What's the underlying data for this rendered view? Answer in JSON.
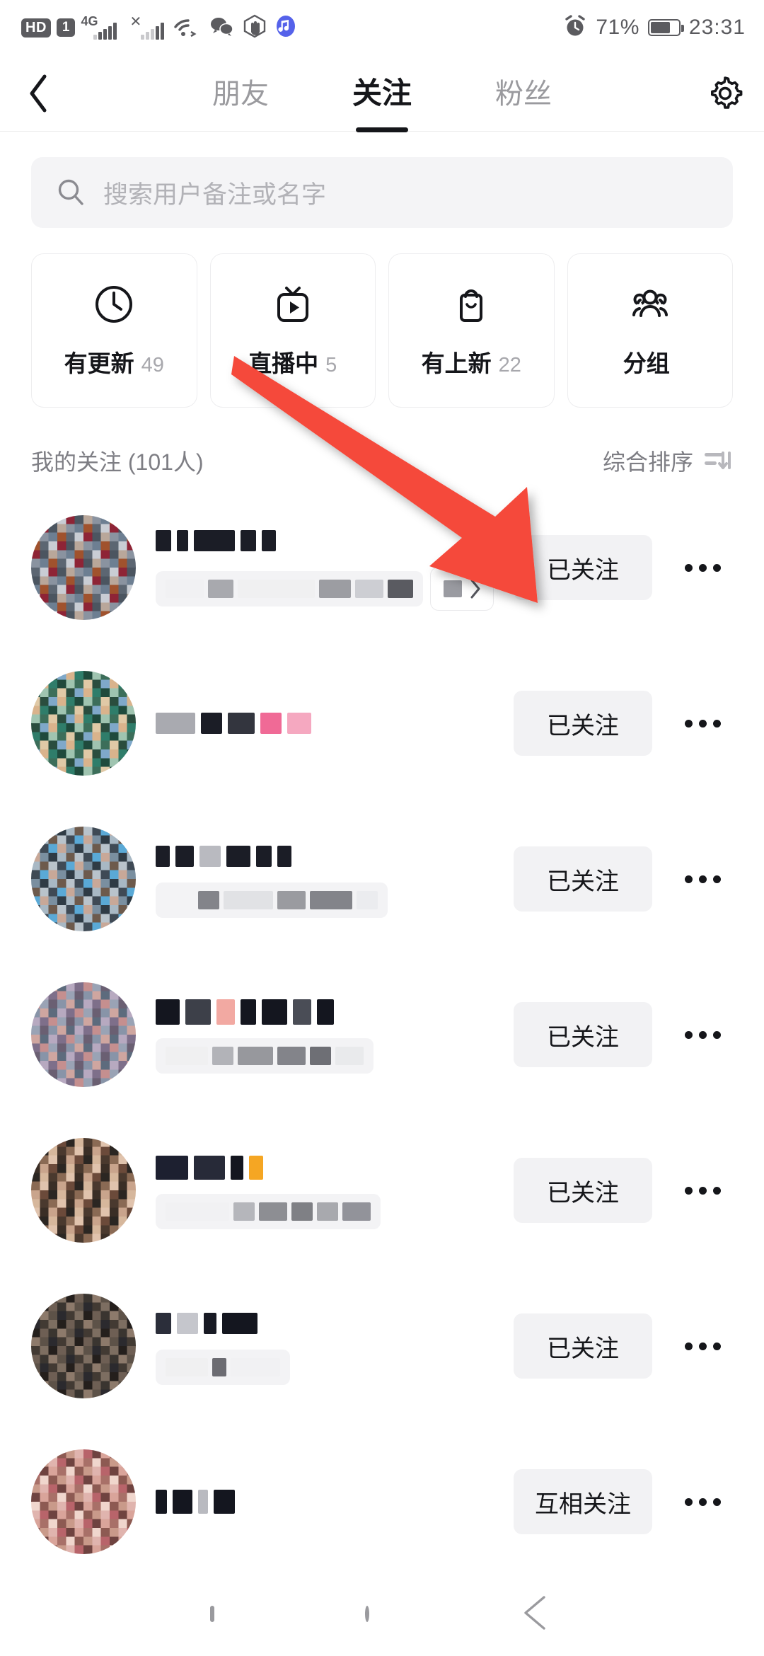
{
  "status_bar": {
    "hd_badge": "HD",
    "sim_badge": "1",
    "network_type": "4G",
    "battery_percent": "71%",
    "time": "23:31",
    "icons": [
      "hd-icon",
      "sim-card-icon",
      "signal-bars-icon",
      "no-signal-icon",
      "wifi-icon",
      "wechat-icon",
      "do-not-disturb-icon",
      "music-icon",
      "alarm-icon",
      "battery-icon"
    ]
  },
  "header": {
    "back_icon": "chevron-left-icon",
    "settings_icon": "gear-icon",
    "tabs": [
      {
        "label": "朋友",
        "active": false
      },
      {
        "label": "关注",
        "active": true
      },
      {
        "label": "粉丝",
        "active": false
      }
    ]
  },
  "search": {
    "placeholder": "搜索用户备注或名字",
    "icon": "search-icon"
  },
  "filter_cards": [
    {
      "label": "有更新",
      "count": "49",
      "icon": "clock-icon"
    },
    {
      "label": "直播中",
      "count": "5",
      "icon": "live-tv-icon"
    },
    {
      "label": "有上新",
      "count": "22",
      "icon": "shopping-bag-icon"
    },
    {
      "label": "分组",
      "count": "",
      "icon": "group-people-icon"
    }
  ],
  "section": {
    "title": "我的关注 (101人)",
    "sort_label": "综合排序",
    "sort_icon": "sort-icon"
  },
  "list": {
    "rows": [
      {
        "name_redacted": true,
        "has_subtitle": true,
        "has_tagchip": true,
        "button": "已关注",
        "more": "more-options-icon"
      },
      {
        "name_redacted": true,
        "has_subtitle": false,
        "has_tagchip": false,
        "button": "已关注",
        "more": "more-options-icon"
      },
      {
        "name_redacted": true,
        "has_subtitle": true,
        "has_tagchip": false,
        "button": "已关注",
        "more": "more-options-icon"
      },
      {
        "name_redacted": true,
        "has_subtitle": true,
        "has_tagchip": false,
        "button": "已关注",
        "more": "more-options-icon"
      },
      {
        "name_redacted": true,
        "has_subtitle": true,
        "has_tagchip": false,
        "button": "已关注",
        "more": "more-options-icon"
      },
      {
        "name_redacted": true,
        "has_subtitle": true,
        "has_tagchip": false,
        "button": "已关注",
        "more": "more-options-icon"
      },
      {
        "name_redacted": true,
        "has_subtitle": false,
        "has_tagchip": false,
        "button": "互相关注",
        "more": "more-options-icon"
      }
    ]
  },
  "annotation": {
    "type": "arrow",
    "color": "#F5483B",
    "points_to": "已关注"
  },
  "nav_bar": {
    "recents_icon": "square-icon",
    "home_icon": "circle-icon",
    "back_icon": "triangle-back-icon"
  },
  "colors": {
    "accent_red": "#F5483B",
    "text_primary": "#15161a",
    "text_secondary": "#7e7e84",
    "text_muted": "#a8a8ad",
    "chip_bg": "#f2f2f4",
    "search_bg": "#f4f4f6"
  }
}
